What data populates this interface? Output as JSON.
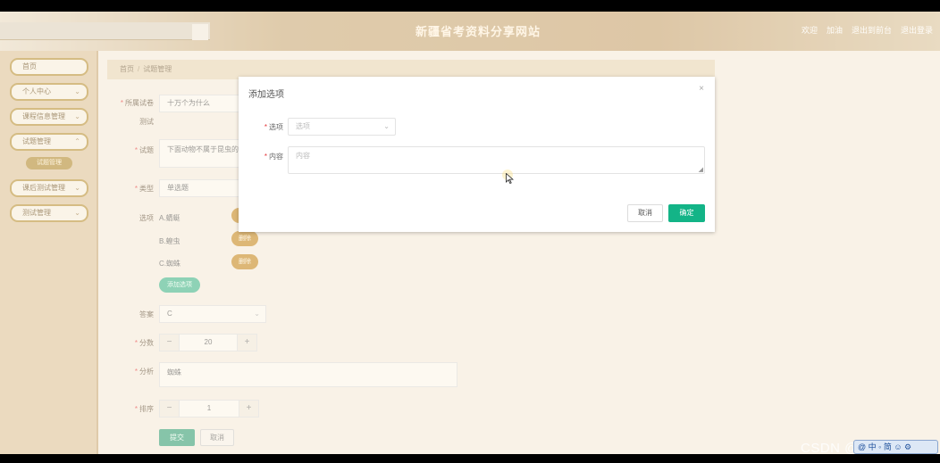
{
  "header": {
    "title": "新疆省考资料分享网站",
    "links": [
      "欢迎",
      "加油",
      "退出到前台",
      "退出登录"
    ]
  },
  "sidebar": {
    "items": [
      {
        "label": "首页",
        "has_chevron": false
      },
      {
        "label": "个人中心",
        "has_chevron": true
      },
      {
        "label": "课程信息管理",
        "has_chevron": true
      },
      {
        "label": "试题管理",
        "has_chevron": true
      },
      {
        "label": "课后测试管理",
        "has_chevron": true
      },
      {
        "label": "测试管理",
        "has_chevron": true
      }
    ],
    "sub_item": "试题管理"
  },
  "breadcrumb": {
    "home": "首页",
    "separator": "/",
    "current": "试题管理"
  },
  "form": {
    "paper_label": "所属试卷",
    "paper_value": "十万个为什么",
    "paper_sub": "测试",
    "question_label": "试题",
    "question_value": "下面动物不属于昆虫的是",
    "type_label": "类型",
    "type_value": "单选题",
    "options_label": "选项",
    "options": [
      {
        "text": "A.蜻蜓",
        "delete": "删除"
      },
      {
        "text": "B.蝗虫",
        "delete": "删除"
      },
      {
        "text": "C.蜘蛛",
        "delete": "删除"
      }
    ],
    "add_option": "添加选项",
    "answer_label": "答案",
    "answer_value": "C",
    "score_label": "分数",
    "score_value": "20",
    "analysis_label": "分析",
    "analysis_value": "蜘蛛",
    "order_label": "排序",
    "order_value": "1",
    "submit": "提交",
    "cancel": "取消",
    "minus": "−",
    "plus": "+"
  },
  "dialog": {
    "title": "添加选项",
    "close": "×",
    "option_label": "选项",
    "option_placeholder": "选项",
    "content_label": "内容",
    "content_placeholder": "内容",
    "cancel": "取消",
    "confirm": "确定"
  },
  "watermark": "CSDN @码农大鸡",
  "tray": "@ 中 ◦ 简 ☺ ⚙"
}
